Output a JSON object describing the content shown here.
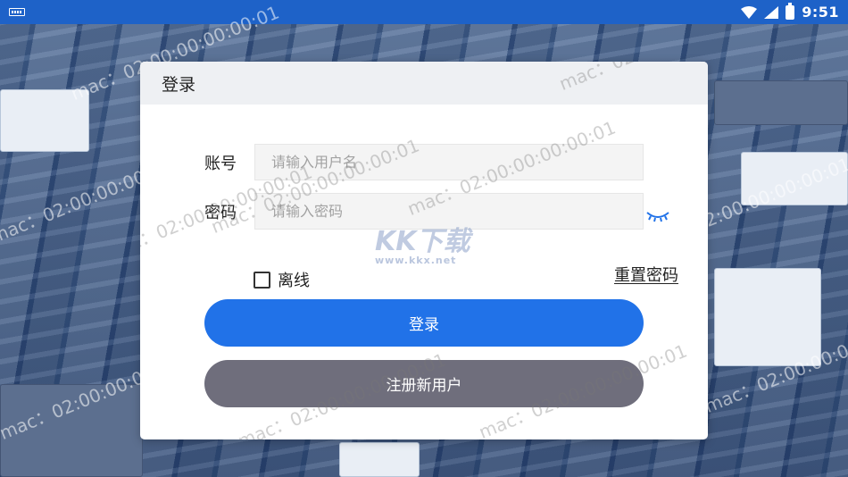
{
  "status_bar": {
    "time": "9:51",
    "icons": [
      "keyboard-icon",
      "wifi-icon",
      "signal-icon",
      "battery-icon"
    ]
  },
  "dialog": {
    "title": "登录",
    "account_label": "账号",
    "account_placeholder": "请输入用户名",
    "account_value": "",
    "password_label": "密码",
    "password_placeholder": "请输入密码",
    "password_value": "",
    "offline_label": "离线",
    "offline_checked": false,
    "reset_password": "重置密码",
    "login_button": "登录",
    "register_button": "注册新用户"
  },
  "watermark": {
    "text": "mac：02:00:00:00:00:01",
    "logo": "KK下载",
    "logo_sub": "www.kkx.net"
  },
  "colors": {
    "status_bar": "#1e62c8",
    "primary_button": "#2172e8",
    "secondary_button": "#6f6e7c",
    "dialog_header": "#eef0f3"
  }
}
